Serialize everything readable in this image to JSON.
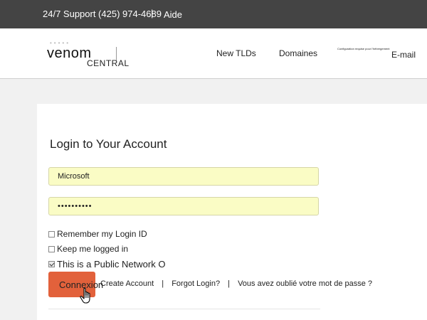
{
  "topbar": {
    "support": "24/7 Support (425) 974-4689",
    "separator": "|",
    "help": "Aide"
  },
  "header": {
    "logo_name": "venom",
    "logo_sub": "CENTRAL",
    "nav": {
      "new_tlds": "New TLDs",
      "domains": "Domaines",
      "config": "Configuration requise pour l'hébergement",
      "email": "E-mail"
    }
  },
  "login": {
    "title": "Login to Your Account",
    "username_value": "Microsoft",
    "password_value": "••••••••••",
    "remember_label": "Remember my Login ID",
    "remember_checked": false,
    "keep_logged_label": "Keep me logged in",
    "keep_logged_checked": false,
    "public_network_label": "This is a Public Network O",
    "public_network_checked": true,
    "submit_label": "Connexion",
    "links": {
      "create": "Create Account",
      "forgot": "Forgot Login?",
      "forgot_fr": "Vous avez oublié votre mot de passe ?",
      "separator": "|"
    }
  },
  "colors": {
    "topbar_bg": "#444444",
    "button_bg": "#e2613b",
    "field_bg": "#fafcc5"
  },
  "icons": {
    "cursor": "hand-pointer-icon"
  }
}
